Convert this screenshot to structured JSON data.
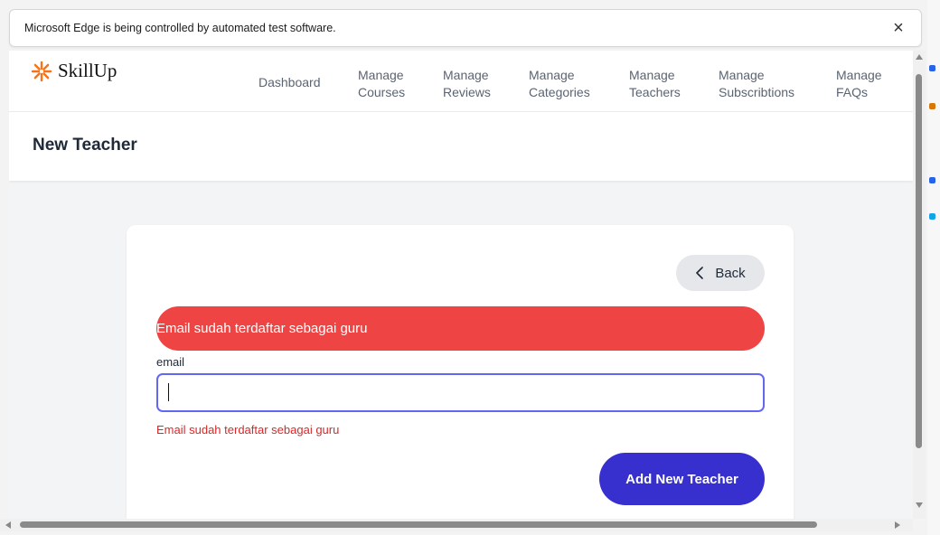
{
  "infobar": {
    "message": "Microsoft Edge is being controlled by automated test software.",
    "close_icon": "×"
  },
  "brand": {
    "name": "SkillUp",
    "logo_color": "#f97316"
  },
  "nav": {
    "items": [
      {
        "line1": "Dashboard",
        "line2": ""
      },
      {
        "line1": "Manage",
        "line2": "Courses"
      },
      {
        "line1": "Manage",
        "line2": "Reviews"
      },
      {
        "line1": "Manage",
        "line2": "Categories"
      },
      {
        "line1": "Manage",
        "line2": "Teachers"
      },
      {
        "line1": "Manage",
        "line2": "Subscribtions"
      },
      {
        "line1": "Manage",
        "line2": "FAQs"
      }
    ]
  },
  "page": {
    "title": "New Teacher"
  },
  "form": {
    "back_label": "Back",
    "alert_message": "Email sudah terdaftar sebagai guru",
    "email_label": "email",
    "email_value": "",
    "email_error": "Email sudah terdaftar sebagai guru",
    "submit_label": "Add New Teacher"
  },
  "colors": {
    "alert": "#ef4444",
    "error_text": "#dc2626",
    "primary": "#3730cf",
    "focus_border": "#6366f1"
  }
}
